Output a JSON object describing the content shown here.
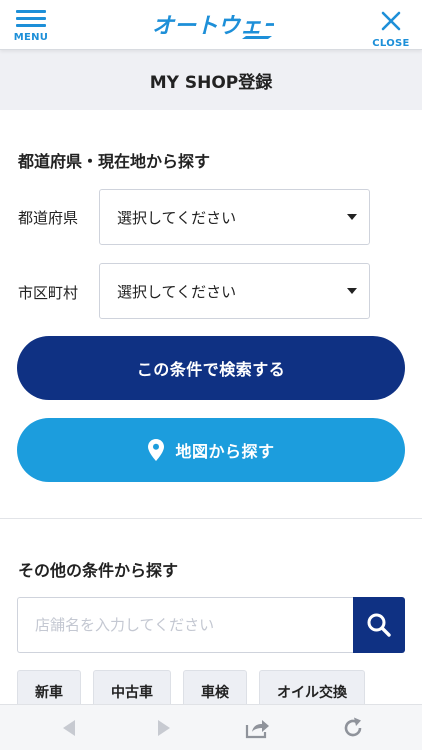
{
  "header": {
    "menu_label": "MENU",
    "logo_text": "オートウェーブ",
    "close_label": "CLOSE",
    "accent_color": "#1d8fd8"
  },
  "page": {
    "title": "MY SHOP登録"
  },
  "location_search": {
    "heading": "都道府県・現在地から探す",
    "prefecture": {
      "label": "都道府県",
      "selected": "選択してください"
    },
    "city": {
      "label": "市区町村",
      "selected": "選択してください"
    },
    "search_button": "この条件で検索する",
    "map_button": "地図から探す",
    "primary_color": "#0f3183",
    "map_color": "#1c9ddd"
  },
  "other_search": {
    "heading": "その他の条件から探す",
    "input": {
      "value": "",
      "placeholder": "店舗名を入力してください"
    },
    "search_icon": "search-icon",
    "chips": [
      {
        "label": "新車"
      },
      {
        "label": "中古車"
      },
      {
        "label": "車検"
      },
      {
        "label": "オイル交換"
      }
    ]
  },
  "browser_toolbar": {
    "icons": [
      "back-arrow-icon",
      "forward-arrow-icon",
      "share-icon",
      "reload-icon"
    ]
  }
}
